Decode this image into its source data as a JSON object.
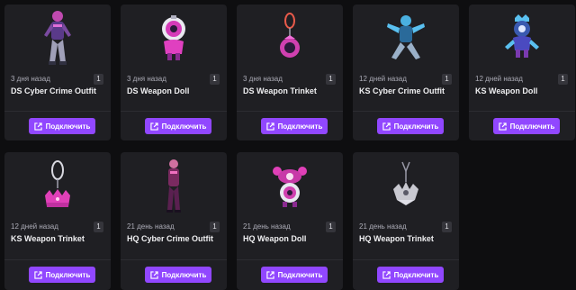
{
  "drops": [
    {
      "time": "3 дня назад",
      "count": "1",
      "title": "DS Cyber Crime Outfit",
      "button": "Подключить",
      "item_icon": "outfit-icon"
    },
    {
      "time": "3 дня назад",
      "count": "1",
      "title": "DS Weapon Doll",
      "button": "Подключить",
      "item_icon": "doll-icon"
    },
    {
      "time": "3 дня назад",
      "count": "1",
      "title": "DS Weapon Trinket",
      "button": "Подключить",
      "item_icon": "trinket-icon"
    },
    {
      "time": "12 дней назад",
      "count": "1",
      "title": "KS Cyber Crime Outfit",
      "button": "Подключить",
      "item_icon": "outfit-icon"
    },
    {
      "time": "12 дней назад",
      "count": "1",
      "title": "KS Weapon Doll",
      "button": "Подключить",
      "item_icon": "doll-icon"
    },
    {
      "time": "12 дней назад",
      "count": "1",
      "title": "KS Weapon Trinket",
      "button": "Подключить",
      "item_icon": "trinket-icon"
    },
    {
      "time": "21 день назад",
      "count": "1",
      "title": "HQ Cyber Crime Outfit",
      "button": "Подключить",
      "item_icon": "outfit-icon"
    },
    {
      "time": "21 день назад",
      "count": "1",
      "title": "HQ Weapon Doll",
      "button": "Подключить",
      "item_icon": "doll-icon"
    },
    {
      "time": "21 день назад",
      "count": "1",
      "title": "HQ Weapon Trinket",
      "button": "Подключить",
      "item_icon": "trinket-icon"
    }
  ],
  "colors": {
    "page_background": "#0e0e10",
    "card_background": "#1f1f23",
    "button_accent": "#9147ff",
    "title_text": "#efeff1",
    "muted_text": "#adadb8"
  }
}
